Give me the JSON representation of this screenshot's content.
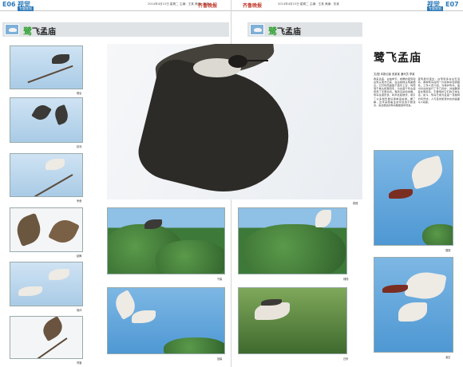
{
  "left_page": {
    "header": {
      "page_number": "E06",
      "section": "视觉",
      "subsection": "专题策划",
      "date_line": "2014年4月15日 星期二 主编：王某 美编：张某",
      "paper_name": "齐鲁晚报"
    },
    "strip": {
      "title_accent": "鹭",
      "title_rest": "飞孟庙"
    },
    "captions": [
      "栖息",
      "嬉戏",
      "争食",
      "起舞",
      "相伴",
      "育雏",
      "守巢",
      "回巢",
      "振翅"
    ]
  },
  "right_page": {
    "header": {
      "page_number": "E07",
      "section": "视觉",
      "subsection": "专题策划",
      "date_line": "2014年4月15日 星期二 主编：王某 美编：张某",
      "paper_name": "齐鲁晚报"
    },
    "strip": {
      "title_accent": "鹭",
      "title_rest": "飞孟庙"
    },
    "article": {
      "title": "鹭飞孟庙",
      "byline": "文/图 本报记者 张某某 通讯员 李某",
      "col1": "春来孟庙，古柏参天，成群的夜鹭和白鹭从南方归来，在古树枝头筑巢栖息。它们时而盘旋于庙宇上空，时而落于枝头梳理羽毛，为这座千年古庙增添了无限生机。每到清晨和傍晚，鹭鸟往返觅食，鸣声此起彼伏，吸引了众多摄影爱好者前来拍摄。据了解，近年来随着生态环境的不断改善，来此栖息的鹭鸟数量逐年增多。",
      "col2": "夜鹭昼伏夜出，白鹭则多在白天活动，两种鹭鸟在同一片树林中和谐相处。工作人员介绍，为保护鹭鸟，庙内对古树进行了专门养护，并提醒游客文明观鸟，不要惊扰它们的正常生活。如今，鹭鸟已成为孟庙一道独特的风景线，人与自然和谐共处的画面令人动容。"
    },
    "captions": [
      "翱翔",
      "归来",
      "展翅",
      "凌空"
    ]
  },
  "colors": {
    "accent_blue": "#2e7ab8",
    "accent_red": "#c0392b",
    "accent_green": "#39a33a",
    "strip_gray": "#dfe3e6"
  }
}
